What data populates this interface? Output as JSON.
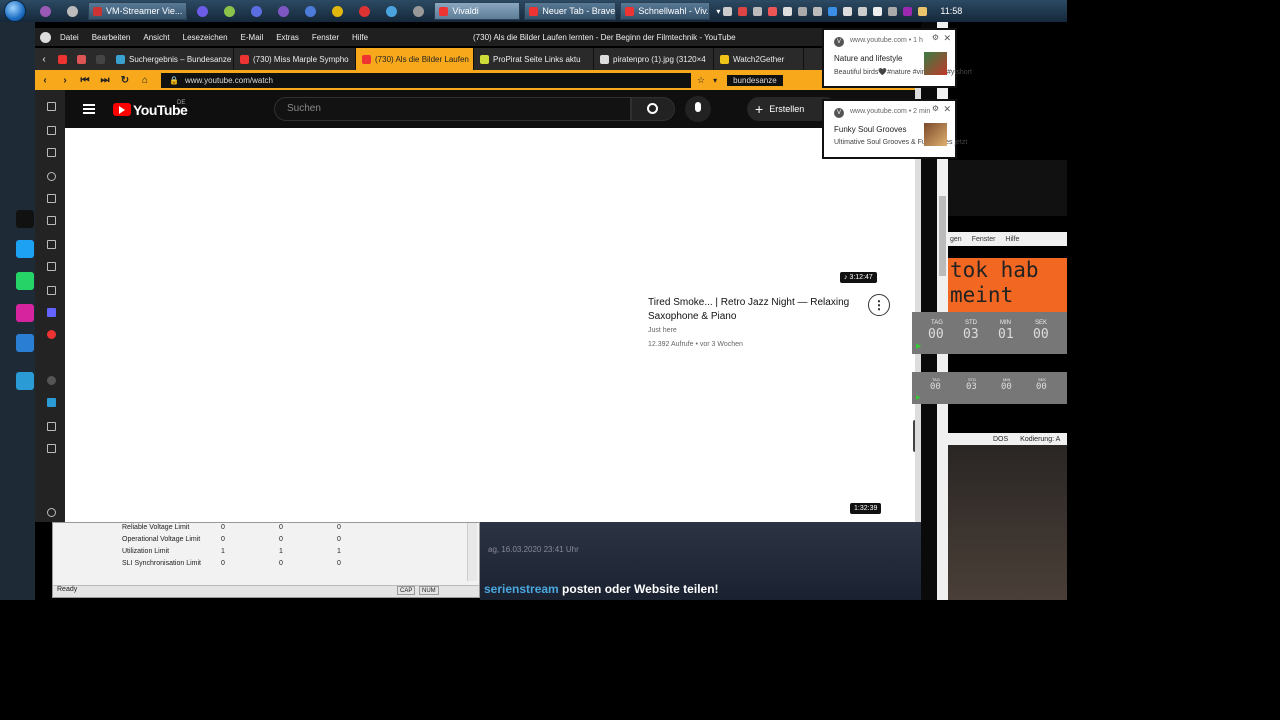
{
  "taskbar": {
    "tasks": [
      {
        "label": "VM-Streamer Vie..."
      },
      {
        "label": "Vivaldi"
      },
      {
        "label": "Neuer Tab - Brave"
      },
      {
        "label": "Schnellwahl - Viv..."
      }
    ],
    "clock": "11:58"
  },
  "browser": {
    "menu": [
      "Datei",
      "Bearbeiten",
      "Ansicht",
      "Lesezeichen",
      "E-Mail",
      "Extras",
      "Fenster",
      "Hilfe"
    ],
    "window_title": "(730) Als die Bilder Laufen lernten - Der Beginn der Filmtechnik - YouTube",
    "tabs": [
      {
        "label": "Suchergebnis – Bundesanze"
      },
      {
        "label": "(730) Miss Marple Sympho"
      },
      {
        "label": "(730) Als die Bilder Laufen"
      },
      {
        "label": "ProPirat Seite Links aktu"
      },
      {
        "label": "piratenpro (1).jpg (3120×4"
      },
      {
        "label": "Watch2Gether"
      }
    ],
    "url": "www.youtube.com/watch",
    "bookmark": "bundesanze"
  },
  "youtube": {
    "logo_text": "YouTube",
    "country": "DE",
    "search_placeholder": "Suchen",
    "create_label": "Erstellen",
    "video": {
      "duration": "3:12:47",
      "title": "Tired Smoke... | Retro Jazz Night — Relaxing Saxophone & Piano",
      "channel": "Just here",
      "meta": "12.392 Aufrufe • vor 3 Wochen"
    },
    "second_duration": "1:32:39"
  },
  "notifications": [
    {
      "source": "www.youtube.com",
      "time": "1 h",
      "title": "Nature and lifestyle",
      "body": "Beautiful birds🖤#nature #viralshort #ytshort"
    },
    {
      "source": "www.youtube.com",
      "time": "2 min",
      "title": "Funky Soul Grooves",
      "body": "Ultimative Soul Grooves & Funk Vibes jetzt"
    }
  ],
  "background_window": {
    "rows": [
      {
        "label": "Reliable Voltage Limit",
        "values": [
          "0",
          "0",
          "0"
        ]
      },
      {
        "label": "Operational Voltage Limit",
        "values": [
          "0",
          "0",
          "0"
        ]
      },
      {
        "label": "Utilization Limit",
        "values": [
          "1",
          "1",
          "1"
        ]
      },
      {
        "label": "SLI Synchronisation Limit",
        "values": [
          "0",
          "0",
          "0"
        ]
      }
    ],
    "status": "Ready",
    "cap": "CAP",
    "num": "NUM"
  },
  "background_page": {
    "date": "ag, 16.03.2020 23:41 Uhr",
    "post_highlight": "serienstream",
    "post_text": " posten oder Website teilen!"
  },
  "right_window": {
    "menu": [
      "gen",
      "Fenster",
      "Hilfe"
    ],
    "big_text_1": "tok hab",
    "big_text_2": "meint",
    "status_left": "DOS",
    "status_right": "Kodierung: A"
  },
  "timer1": {
    "tag_label": "TAG",
    "std_label": "STD",
    "min_label": "MIN",
    "sek_label": "SEK",
    "tag": "00",
    "std": "03",
    "min": "01",
    "sek": "00"
  },
  "timer2": {
    "tag_label": "TAG",
    "std_label": "STD",
    "min_label": "MIN",
    "sek_label": "SEK",
    "tag": "00",
    "std": "03",
    "min": "00",
    "sek": "00"
  }
}
